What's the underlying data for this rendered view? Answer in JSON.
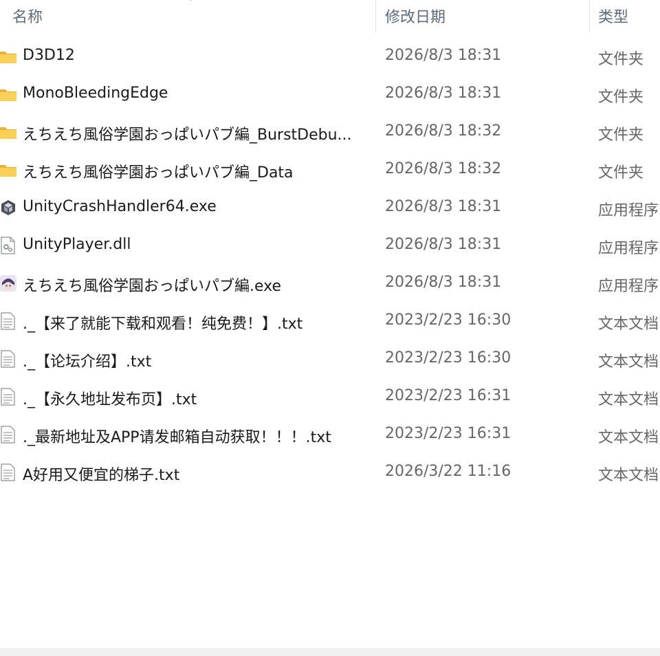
{
  "columns": {
    "name": "名称",
    "date_modified": "修改日期",
    "type": "类型"
  },
  "colors": {
    "header_text": "#5b6b7e",
    "name_text": "#1a1a1a",
    "meta_text": "#666666",
    "folder_yellow": "#f5c542"
  },
  "files": [
    {
      "icon": "folder-icon",
      "name": "D3D12",
      "date": "2026/8/3 18:31",
      "type": "文件夹"
    },
    {
      "icon": "folder-icon",
      "name": "MonoBleedingEdge",
      "date": "2026/8/3 18:31",
      "type": "文件夹"
    },
    {
      "icon": "folder-icon",
      "name": "えちえち風俗学園おっぱいパブ編_BurstDebu...",
      "date": "2026/8/3 18:32",
      "type": "文件夹"
    },
    {
      "icon": "folder-icon",
      "name": "えちえち風俗学園おっぱいパブ編_Data",
      "date": "2026/8/3 18:32",
      "type": "文件夹"
    },
    {
      "icon": "unity-icon",
      "name": "UnityCrashHandler64.exe",
      "date": "2026/8/3 18:31",
      "type": "应用程序"
    },
    {
      "icon": "dll-file-icon",
      "name": "UnityPlayer.dll",
      "date": "2026/8/3 18:31",
      "type": "应用程序"
    },
    {
      "icon": "game-app-icon",
      "name": "えちえち風俗学園おっぱいパブ編.exe",
      "date": "2026/8/3 18:31",
      "type": "应用程序"
    },
    {
      "icon": "text-file-icon",
      "name": "._【来了就能下载和观看！纯免费！】.txt",
      "date": "2023/2/23 16:30",
      "type": "文本文档"
    },
    {
      "icon": "text-file-icon",
      "name": "._【论坛介绍】.txt",
      "date": "2023/2/23 16:30",
      "type": "文本文档"
    },
    {
      "icon": "text-file-icon",
      "name": "._【永久地址发布页】.txt",
      "date": "2023/2/23 16:31",
      "type": "文本文档"
    },
    {
      "icon": "text-file-icon",
      "name": "._最新地址及APP请发邮箱自动获取！！！.txt",
      "date": "2023/2/23 16:31",
      "type": "文本文档"
    },
    {
      "icon": "text-file-icon",
      "name": "A好用又便宜的梯子.txt",
      "date": "2026/3/22 11:16",
      "type": "文本文档"
    }
  ]
}
